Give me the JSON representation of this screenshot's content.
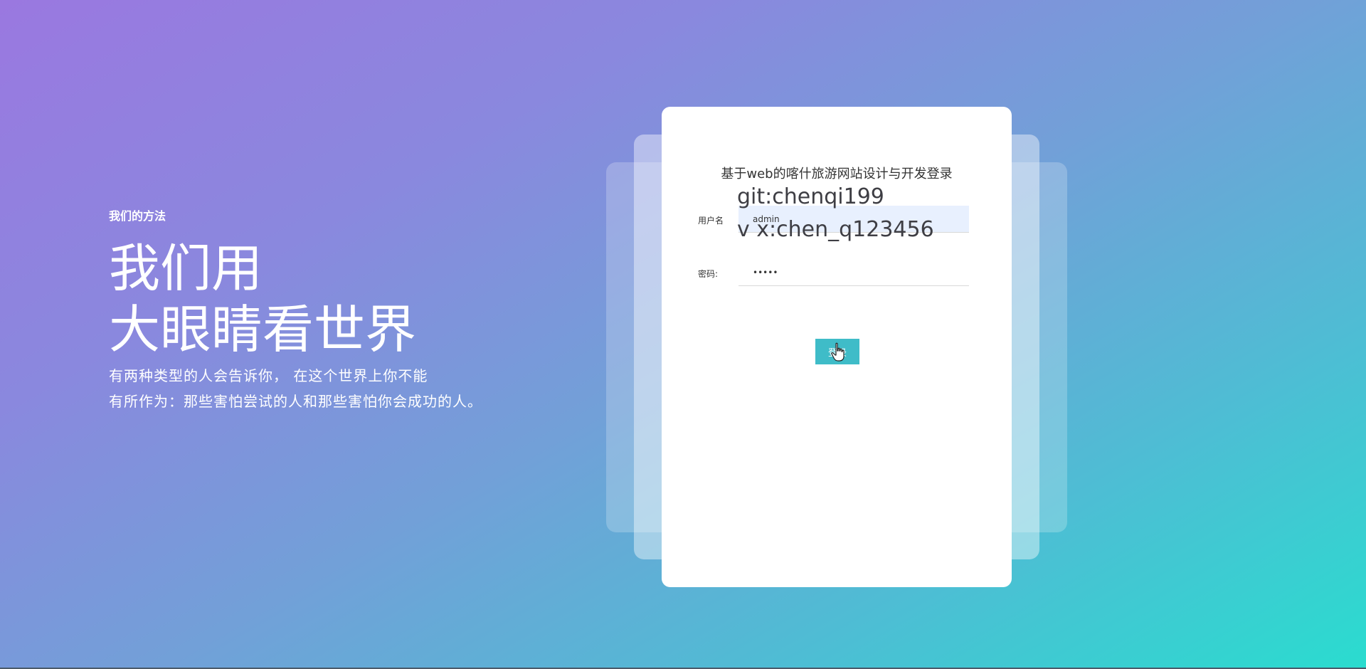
{
  "hero": {
    "kicker": "我们的方法",
    "title_line1": "我们用",
    "title_line2": "大眼睛看世界",
    "desc_line1": "有两种类型的人会告诉你， 在这个世界上你不能",
    "desc_line2": "有所作为：那些害怕尝试的人和那些害怕你会成功的人。"
  },
  "login": {
    "title": "基于web的喀什旅游网站设计与开发登录",
    "username_label": "用户名",
    "username_value": "admin",
    "password_label": "密码:",
    "password_value": "•••••",
    "button_label": "登录"
  },
  "watermark": {
    "line1": "git:chenqi199",
    "line2": "v x:chen_q123456"
  },
  "icons": {
    "cursor": "hand-pointer-icon"
  },
  "colors": {
    "gradient_start": "#9a78e0",
    "gradient_end": "#2adccf",
    "button": "#3fbcc8",
    "username_field_bg": "#e8f0fe"
  }
}
